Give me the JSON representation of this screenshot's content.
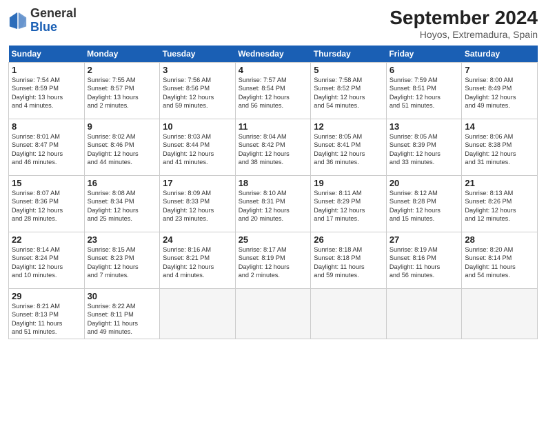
{
  "header": {
    "logo_general": "General",
    "logo_blue": "Blue",
    "month_title": "September 2024",
    "location": "Hoyos, Extremadura, Spain"
  },
  "days_of_week": [
    "Sunday",
    "Monday",
    "Tuesday",
    "Wednesday",
    "Thursday",
    "Friday",
    "Saturday"
  ],
  "weeks": [
    [
      {
        "day": 1,
        "sunrise": "7:54 AM",
        "sunset": "8:59 PM",
        "daylight": "13 hours and 4 minutes."
      },
      {
        "day": 2,
        "sunrise": "7:55 AM",
        "sunset": "8:57 PM",
        "daylight": "13 hours and 2 minutes."
      },
      {
        "day": 3,
        "sunrise": "7:56 AM",
        "sunset": "8:56 PM",
        "daylight": "12 hours and 59 minutes."
      },
      {
        "day": 4,
        "sunrise": "7:57 AM",
        "sunset": "8:54 PM",
        "daylight": "12 hours and 56 minutes."
      },
      {
        "day": 5,
        "sunrise": "7:58 AM",
        "sunset": "8:52 PM",
        "daylight": "12 hours and 54 minutes."
      },
      {
        "day": 6,
        "sunrise": "7:59 AM",
        "sunset": "8:51 PM",
        "daylight": "12 hours and 51 minutes."
      },
      {
        "day": 7,
        "sunrise": "8:00 AM",
        "sunset": "8:49 PM",
        "daylight": "12 hours and 49 minutes."
      }
    ],
    [
      {
        "day": 8,
        "sunrise": "8:01 AM",
        "sunset": "8:47 PM",
        "daylight": "12 hours and 46 minutes."
      },
      {
        "day": 9,
        "sunrise": "8:02 AM",
        "sunset": "8:46 PM",
        "daylight": "12 hours and 44 minutes."
      },
      {
        "day": 10,
        "sunrise": "8:03 AM",
        "sunset": "8:44 PM",
        "daylight": "12 hours and 41 minutes."
      },
      {
        "day": 11,
        "sunrise": "8:04 AM",
        "sunset": "8:42 PM",
        "daylight": "12 hours and 38 minutes."
      },
      {
        "day": 12,
        "sunrise": "8:05 AM",
        "sunset": "8:41 PM",
        "daylight": "12 hours and 36 minutes."
      },
      {
        "day": 13,
        "sunrise": "8:05 AM",
        "sunset": "8:39 PM",
        "daylight": "12 hours and 33 minutes."
      },
      {
        "day": 14,
        "sunrise": "8:06 AM",
        "sunset": "8:38 PM",
        "daylight": "12 hours and 31 minutes."
      }
    ],
    [
      {
        "day": 15,
        "sunrise": "8:07 AM",
        "sunset": "8:36 PM",
        "daylight": "12 hours and 28 minutes."
      },
      {
        "day": 16,
        "sunrise": "8:08 AM",
        "sunset": "8:34 PM",
        "daylight": "12 hours and 25 minutes."
      },
      {
        "day": 17,
        "sunrise": "8:09 AM",
        "sunset": "8:33 PM",
        "daylight": "12 hours and 23 minutes."
      },
      {
        "day": 18,
        "sunrise": "8:10 AM",
        "sunset": "8:31 PM",
        "daylight": "12 hours and 20 minutes."
      },
      {
        "day": 19,
        "sunrise": "8:11 AM",
        "sunset": "8:29 PM",
        "daylight": "12 hours and 17 minutes."
      },
      {
        "day": 20,
        "sunrise": "8:12 AM",
        "sunset": "8:28 PM",
        "daylight": "12 hours and 15 minutes."
      },
      {
        "day": 21,
        "sunrise": "8:13 AM",
        "sunset": "8:26 PM",
        "daylight": "12 hours and 12 minutes."
      }
    ],
    [
      {
        "day": 22,
        "sunrise": "8:14 AM",
        "sunset": "8:24 PM",
        "daylight": "12 hours and 10 minutes."
      },
      {
        "day": 23,
        "sunrise": "8:15 AM",
        "sunset": "8:23 PM",
        "daylight": "12 hours and 7 minutes."
      },
      {
        "day": 24,
        "sunrise": "8:16 AM",
        "sunset": "8:21 PM",
        "daylight": "12 hours and 4 minutes."
      },
      {
        "day": 25,
        "sunrise": "8:17 AM",
        "sunset": "8:19 PM",
        "daylight": "12 hours and 2 minutes."
      },
      {
        "day": 26,
        "sunrise": "8:18 AM",
        "sunset": "8:18 PM",
        "daylight": "11 hours and 59 minutes."
      },
      {
        "day": 27,
        "sunrise": "8:19 AM",
        "sunset": "8:16 PM",
        "daylight": "11 hours and 56 minutes."
      },
      {
        "day": 28,
        "sunrise": "8:20 AM",
        "sunset": "8:14 PM",
        "daylight": "11 hours and 54 minutes."
      }
    ],
    [
      {
        "day": 29,
        "sunrise": "8:21 AM",
        "sunset": "8:13 PM",
        "daylight": "11 hours and 51 minutes."
      },
      {
        "day": 30,
        "sunrise": "8:22 AM",
        "sunset": "8:11 PM",
        "daylight": "11 hours and 49 minutes."
      },
      null,
      null,
      null,
      null,
      null
    ]
  ]
}
